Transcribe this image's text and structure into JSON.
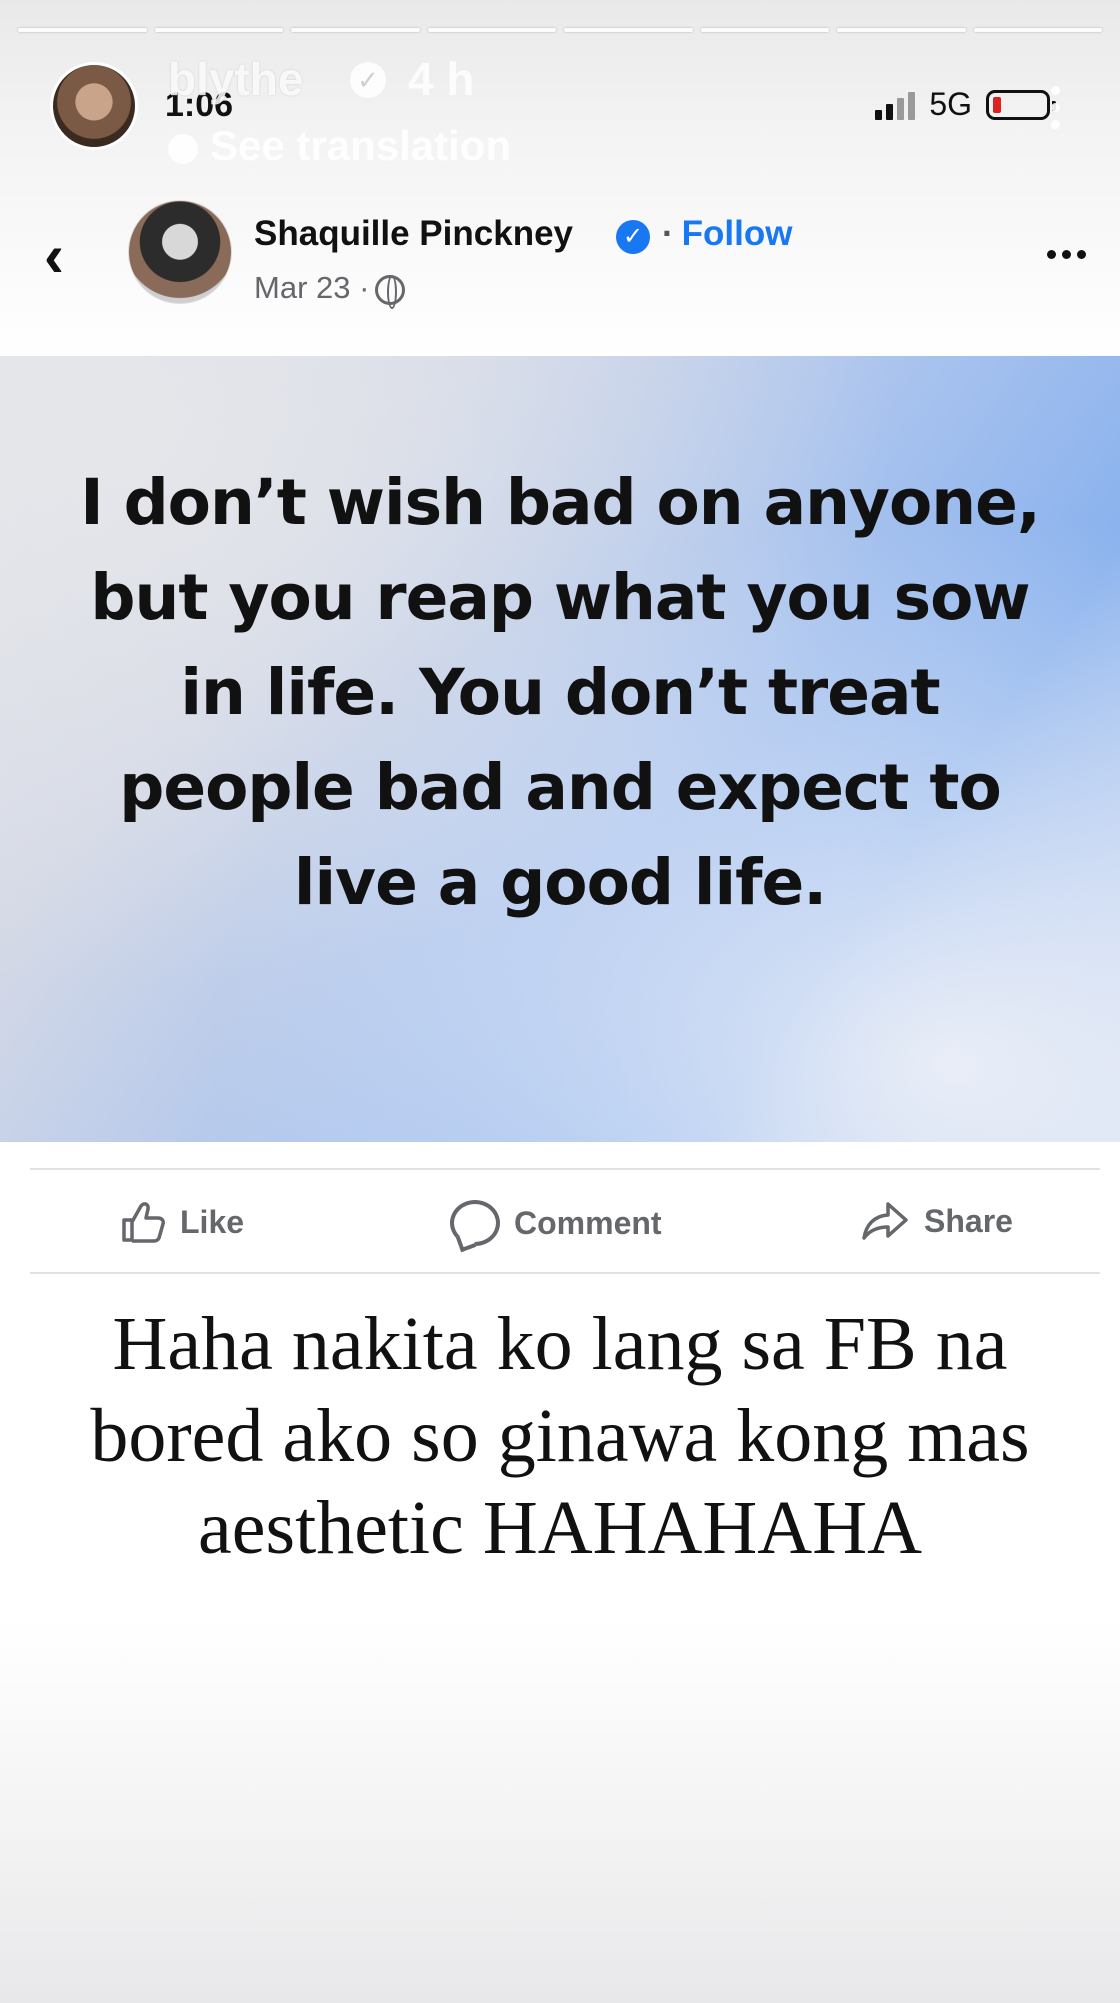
{
  "story": {
    "username": "blythe",
    "time_ago": "4 h",
    "see_translation": "See translation",
    "progress_segments": 8
  },
  "status_bar": {
    "time": "1:06",
    "network": "5G"
  },
  "post": {
    "author": "Shaquille Pinckney",
    "follow_label": "Follow",
    "separator": "·",
    "date": "Mar 23 ·",
    "text": "I don’t wish bad on anyone, but you reap what you sow in life. You don’t treat people bad and expect to live a good life.",
    "actions": {
      "like": "Like",
      "comment": "Comment",
      "share": "Share"
    },
    "colors": {
      "brand": "#1877f2",
      "muted": "#65676b"
    }
  },
  "caption": "Haha nakita ko lang sa FB na bored ako so ginawa kong mas aesthetic HAHAHAHA"
}
